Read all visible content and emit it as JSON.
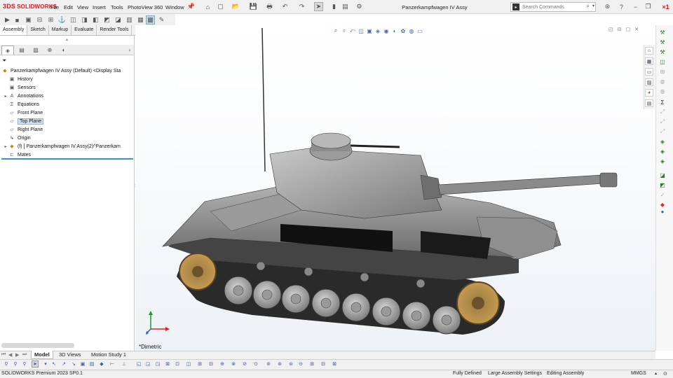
{
  "app": {
    "brand": "SOLIDWORKS",
    "brand_prefix": "3DS",
    "doc_title": "Panzerkampfwagen IV Assy"
  },
  "menu": [
    "File",
    "Edit",
    "View",
    "Insert",
    "Tools",
    "PhotoView 360",
    "Window"
  ],
  "search": {
    "placeholder": "Search Commands"
  },
  "command_tabs": [
    "Assembly",
    "Sketch",
    "Markup",
    "Evaluate",
    "Render Tools"
  ],
  "tree": {
    "root": "Panzerkampfwagen IV Assy (Default) <Display Sta",
    "items": [
      {
        "label": "History",
        "icon": "history-icon"
      },
      {
        "label": "Sensors",
        "icon": "sensors-icon"
      },
      {
        "label": "Annotations",
        "icon": "annotations-icon"
      },
      {
        "label": "Equations",
        "icon": "equations-icon"
      },
      {
        "label": "Front Plane",
        "icon": "plane-icon"
      },
      {
        "label": "Top Plane",
        "icon": "plane-icon",
        "selected": true
      },
      {
        "label": "Right Plane",
        "icon": "plane-icon"
      },
      {
        "label": "Origin",
        "icon": "origin-icon"
      },
      {
        "label": "(f) [ Panzerkampfwagen IV Assy(2)^Panzerkam",
        "icon": "subassembly-icon"
      },
      {
        "label": "Mates",
        "icon": "mates-icon"
      }
    ]
  },
  "viewport": {
    "view_name": "*Dimetric"
  },
  "bottom_tabs": [
    "Model",
    "3D Views",
    "Motion Study 1"
  ],
  "status": {
    "version": "SOLIDWORKS Premium 2023 SP0.1",
    "defined": "Fully Defined",
    "settings": "Large Assembly Settings",
    "mode": "Editing Assembly",
    "units": "MMGS"
  },
  "colors": {
    "brand": "#d41f29",
    "accent": "#3b8fd6",
    "selection": "#cde4f7"
  }
}
